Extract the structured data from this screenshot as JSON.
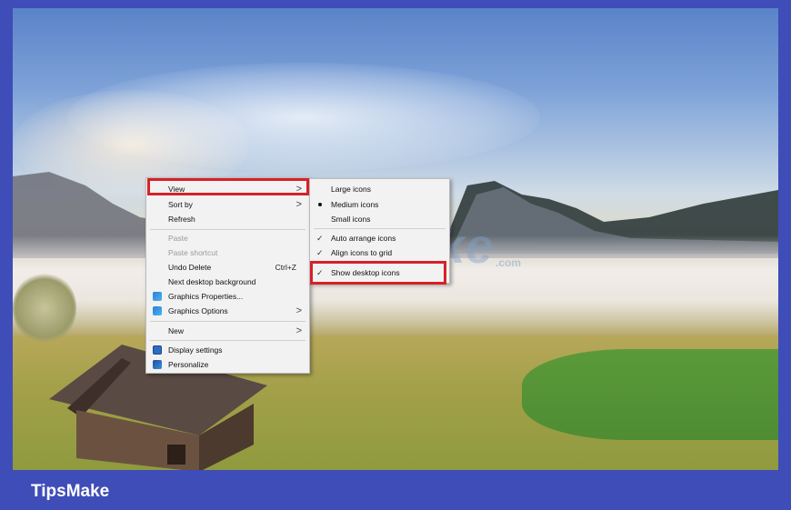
{
  "footer": {
    "brand": "TipsMake"
  },
  "watermark": {
    "text": "TipsMake",
    "suffix": ".com"
  },
  "context_menu": {
    "items": [
      {
        "label": "View",
        "has_submenu": true,
        "disabled": false
      },
      {
        "label": "Sort by",
        "has_submenu": true,
        "disabled": false
      },
      {
        "label": "Refresh",
        "has_submenu": false,
        "disabled": false
      },
      {
        "label": "Paste",
        "has_submenu": false,
        "disabled": true
      },
      {
        "label": "Paste shortcut",
        "has_submenu": false,
        "disabled": true
      },
      {
        "label": "Undo Delete",
        "shortcut": "Ctrl+Z",
        "has_submenu": false,
        "disabled": false
      },
      {
        "label": "Next desktop background",
        "has_submenu": false,
        "disabled": false
      },
      {
        "label": "Graphics Properties...",
        "icon": "graphics-icon",
        "has_submenu": false,
        "disabled": false
      },
      {
        "label": "Graphics Options",
        "icon": "graphics-icon",
        "has_submenu": true,
        "disabled": false
      },
      {
        "label": "New",
        "has_submenu": true,
        "disabled": false
      },
      {
        "label": "Display settings",
        "icon": "display-icon",
        "has_submenu": false,
        "disabled": false
      },
      {
        "label": "Personalize",
        "icon": "personalize-icon",
        "has_submenu": false,
        "disabled": false
      }
    ]
  },
  "view_submenu": {
    "items": [
      {
        "label": "Large icons",
        "state": "none"
      },
      {
        "label": "Medium icons",
        "state": "selected"
      },
      {
        "label": "Small icons",
        "state": "none"
      },
      {
        "label": "Auto arrange icons",
        "state": "checked"
      },
      {
        "label": "Align icons to grid",
        "state": "checked"
      },
      {
        "label": "Show desktop icons",
        "state": "checked"
      }
    ]
  },
  "colors": {
    "frame": "#3f4db8",
    "highlight": "#d62128",
    "menu_bg": "#f2f2f2"
  }
}
